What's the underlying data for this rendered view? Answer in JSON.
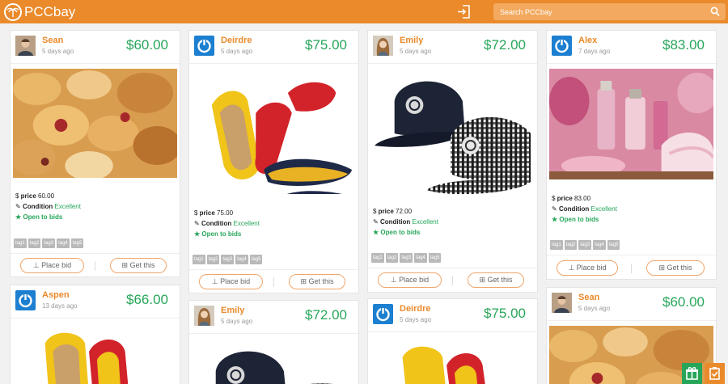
{
  "app": {
    "logo_text": "PCCbay"
  },
  "search": {
    "placeholder": "Search PCCbay"
  },
  "labels": {
    "price": "price",
    "condition": "Condition",
    "open_bids": "Open to bids",
    "place_bid": "Place bid",
    "get_this": "Get this"
  },
  "cards": [
    {
      "name": "Sean",
      "ago": "5 days ago",
      "price": "$60.00",
      "price_value": "60.00",
      "condition": "Excellent",
      "image": "pastries",
      "tags": [
        "tag1",
        "tag2",
        "tag3",
        "tag4",
        "tag5"
      ]
    },
    {
      "name": "Deirdre",
      "ago": "5 days ago",
      "price": "$75.00",
      "price_value": "75.00",
      "condition": "Excellent",
      "image": "shoes",
      "tags": [
        "tag1",
        "tag2",
        "tag3",
        "tag4",
        "tag5"
      ]
    },
    {
      "name": "Emily",
      "ago": "5 days ago",
      "price": "$72.00",
      "price_value": "72.00",
      "condition": "Excellent",
      "image": "caps",
      "tags": [
        "tag1",
        "tag2",
        "tag3",
        "tag4",
        "tag5"
      ]
    },
    {
      "name": "Alex",
      "ago": "7 days ago",
      "price": "$83.00",
      "price_value": "83.00",
      "condition": "Excellent",
      "image": "spa",
      "tags": [
        "tag1",
        "tag2",
        "tag3",
        "tag4",
        "tag5"
      ]
    },
    {
      "name": "Aspen",
      "ago": "13 days ago",
      "price": "$66.00",
      "image": "shoes"
    },
    {
      "name": "Emily",
      "ago": "5 days ago",
      "price": "$72.00",
      "image": "caps"
    },
    {
      "name": "Deirdre",
      "ago": "5 days ago",
      "price": "$75.00",
      "image": "shoes"
    },
    {
      "name": "Sean",
      "ago": "5 days ago",
      "price": "$60.00",
      "image": "pastries"
    }
  ],
  "colors": {
    "brand_orange": "#ea8a2b",
    "price_green": "#27a65a",
    "fab_green": "#27a65a",
    "fab_orange": "#ea8a2b"
  },
  "icons": {
    "login": "login-icon",
    "search": "search-icon",
    "fab_gift": "gift-icon",
    "fab_check": "checklist-icon"
  }
}
